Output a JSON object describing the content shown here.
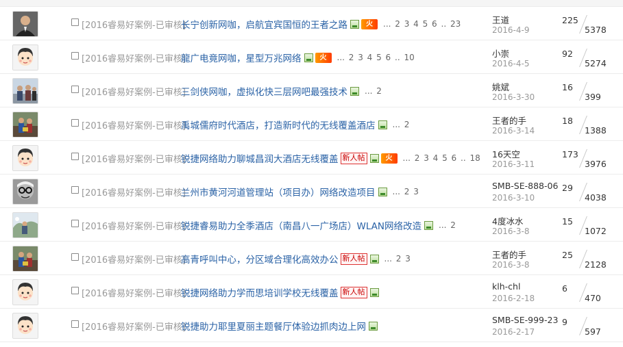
{
  "rows": [
    {
      "avatar": "photo-man-suit",
      "category": "[2016睿易好案例-已审核]",
      "title": "长宁创新网咖，启航宜宾国恒的王者之路",
      "badges": [
        "img",
        "hot"
      ],
      "pages": "... 2 3 4 5 6 .. 23",
      "author": "王道",
      "date": "2016-4-9",
      "replies": "225",
      "views": "5378"
    },
    {
      "avatar": "cartoon-boy",
      "category": "[2016睿易好案例-已审核]",
      "title": "龍广电竟网咖，星型万兆网络",
      "badges": [
        "img",
        "hot"
      ],
      "pages": "... 2 3 4 5 6 .. 10",
      "author": "小崇",
      "date": "2016-4-5",
      "replies": "92",
      "views": "5274"
    },
    {
      "avatar": "photo-group",
      "category": "[2016睿易好案例-已审核]",
      "title": "三剑侠网咖，虚拟化快三层网吧最强技术",
      "badges": [
        "img"
      ],
      "pages": "... 2",
      "author": "姚斌",
      "date": "2016-3-30",
      "replies": "16",
      "views": "399"
    },
    {
      "avatar": "photo-people",
      "category": "[2016睿易好案例-已审核]",
      "title": "禹城儒府时代酒店，打造新时代的无线覆盖酒店",
      "badges": [
        "img"
      ],
      "pages": "... 2",
      "author": "王者的手",
      "date": "2016-3-14",
      "replies": "18",
      "views": "1388"
    },
    {
      "avatar": "cartoon-boy",
      "category": "[2016睿易好案例-已审核]",
      "title": "锐捷网络助力聊城昌润大酒店无线覆盖",
      "badges": [
        "new",
        "img",
        "hot"
      ],
      "pages": "... 2 3 4 5 6 .. 18",
      "author": "16天空",
      "date": "2016-3-11",
      "replies": "173",
      "views": "3976"
    },
    {
      "avatar": "photo-glasses",
      "category": "[2016睿易好案例-已审核]",
      "title": "兰州市黄河河道管理站（项目办）网络改造项目",
      "badges": [
        "img"
      ],
      "pages": "... 2 3",
      "author": "SMB-SE-888-06",
      "date": "2016-3-10",
      "replies": "29",
      "views": "4038"
    },
    {
      "avatar": "photo-outdoor",
      "category": "[2016睿易好案例-已审核]",
      "title": "锐捷睿易助力全季酒店（南昌八一广场店）WLAN网络改造",
      "badges": [
        "img"
      ],
      "pages": "... 2",
      "author": "4度冰水",
      "date": "2016-3-8",
      "replies": "15",
      "views": "1072"
    },
    {
      "avatar": "photo-people",
      "category": "[2016睿易好案例-已审核]",
      "title": "高青呼叫中心，分区域合理化高效办公",
      "badges": [
        "new",
        "img"
      ],
      "pages": "... 2 3",
      "author": "王者的手",
      "date": "2016-3-8",
      "replies": "25",
      "views": "2128"
    },
    {
      "avatar": "cartoon-boy",
      "category": "[2016睿易好案例-已审核]",
      "title": "锐捷网络助力学而思培训学校无线覆盖",
      "badges": [
        "new",
        "img"
      ],
      "pages": "",
      "author": "klh-chl",
      "date": "2016-2-18",
      "replies": "6",
      "views": "470"
    },
    {
      "avatar": "cartoon-boy",
      "category": "[2016睿易好案例-已审核]",
      "title": "锐捷助力耶里夏丽主题餐厅体验边抓肉边上网",
      "badges": [
        "img"
      ],
      "pages": "",
      "author": "SMB-SE-999-23",
      "date": "2016-2-17",
      "replies": "9",
      "views": "597"
    }
  ],
  "badge_labels": {
    "hot": "火",
    "new": "新人帖"
  },
  "colors": {
    "title": "#2a62a6",
    "category": "#999999",
    "hot": "#ff5a00",
    "new": "#c80000"
  }
}
